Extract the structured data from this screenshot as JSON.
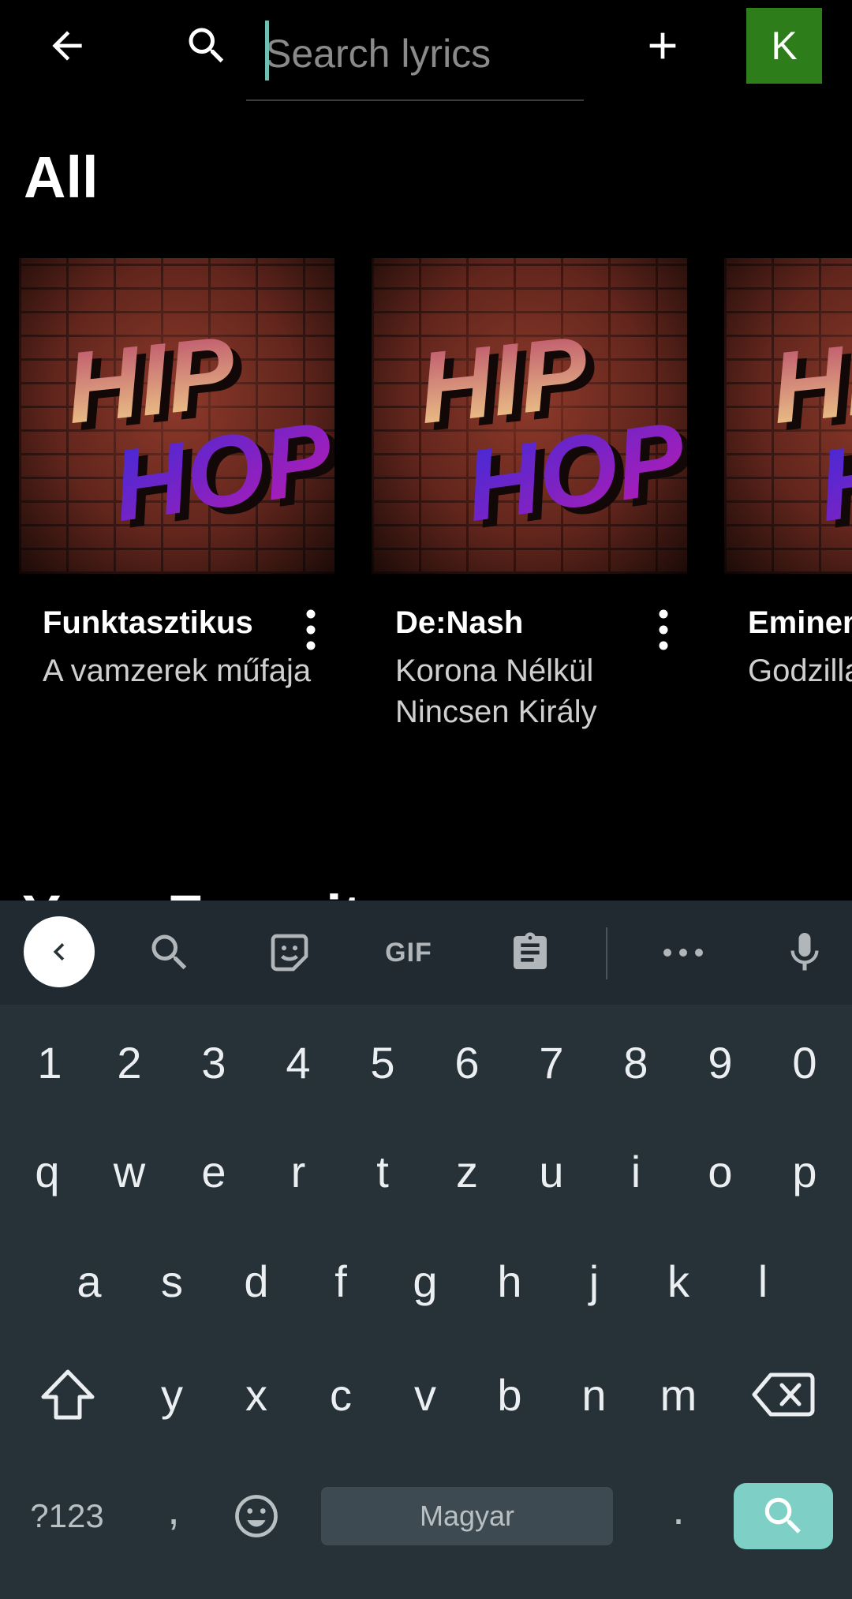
{
  "header": {
    "search_placeholder": "Search lyrics",
    "avatar_letter": "K"
  },
  "section": {
    "title": "All"
  },
  "cards": [
    {
      "title": "Funktasztikus",
      "subtitle": "A vamzerek műfaja",
      "cover_text": [
        "HIP",
        "HOP"
      ]
    },
    {
      "title": "De:Nash",
      "subtitle": "Korona Nélkül Nincsen Király",
      "cover_text": [
        "HIP",
        "HOP"
      ]
    },
    {
      "title": "Eminem",
      "subtitle": "Godzilla",
      "cover_text": [
        "HIP",
        "HOP"
      ]
    }
  ],
  "next_section": {
    "title": "Your Favorites"
  },
  "keyboard": {
    "toolbar": [
      "collapse",
      "search",
      "sticker",
      "GIF",
      "clipboard",
      "more",
      "mic"
    ],
    "gif_label": "GIF",
    "number_row": [
      "1",
      "2",
      "3",
      "4",
      "5",
      "6",
      "7",
      "8",
      "9",
      "0"
    ],
    "row1": [
      "q",
      "w",
      "e",
      "r",
      "t",
      "z",
      "u",
      "i",
      "o",
      "p"
    ],
    "row2": [
      "a",
      "s",
      "d",
      "f",
      "g",
      "h",
      "j",
      "k",
      "l"
    ],
    "row3": [
      "y",
      "x",
      "c",
      "v",
      "b",
      "n",
      "m"
    ],
    "symbols_label": "?123",
    "comma": ",",
    "period": ".",
    "space_label": "Magyar"
  },
  "colors": {
    "avatar_bg": "#2e7d1b",
    "keyboard_bg": "#263238",
    "enter_key": "#7ed0c6",
    "caret": "#6fbfb4"
  }
}
